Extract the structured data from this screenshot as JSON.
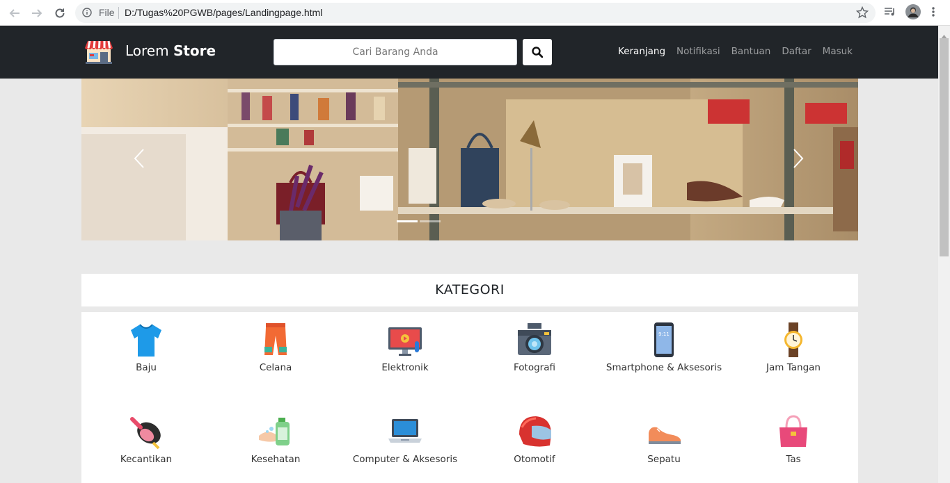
{
  "browser": {
    "scheme_label": "File",
    "url": "D:/Tugas%20PGWB/pages/Landingpage.html"
  },
  "navbar": {
    "brand_light": "Lorem",
    "brand_bold": "Store",
    "search_placeholder": "Cari Barang Anda",
    "menu": [
      "Keranjang",
      "Notifikasi",
      "Bantuan",
      "Daftar",
      "Masuk"
    ],
    "active_menu": "Keranjang"
  },
  "carousel": {
    "slides": 2,
    "active_slide": 1
  },
  "kategori": {
    "title": "KATEGORI",
    "items": [
      {
        "label": "Baju",
        "icon": "shirt-icon"
      },
      {
        "label": "Celana",
        "icon": "pants-icon"
      },
      {
        "label": "Elektronik",
        "icon": "monitor-icon"
      },
      {
        "label": "Fotografi",
        "icon": "camera-icon"
      },
      {
        "label": "Smartphone & Aksesoris",
        "icon": "smartphone-icon"
      },
      {
        "label": "Jam Tangan",
        "icon": "watch-icon"
      },
      {
        "label": "Kecantikan",
        "icon": "cosmetics-icon"
      },
      {
        "label": "Kesehatan",
        "icon": "handwash-icon"
      },
      {
        "label": "Computer & Aksesoris",
        "icon": "laptop-icon"
      },
      {
        "label": "Otomotif",
        "icon": "helmet-icon"
      },
      {
        "label": "Sepatu",
        "icon": "shoe-icon"
      },
      {
        "label": "Tas",
        "icon": "bag-icon"
      }
    ]
  },
  "colors": {
    "navbar_bg": "#212529",
    "page_bg": "#e9e9e9"
  }
}
